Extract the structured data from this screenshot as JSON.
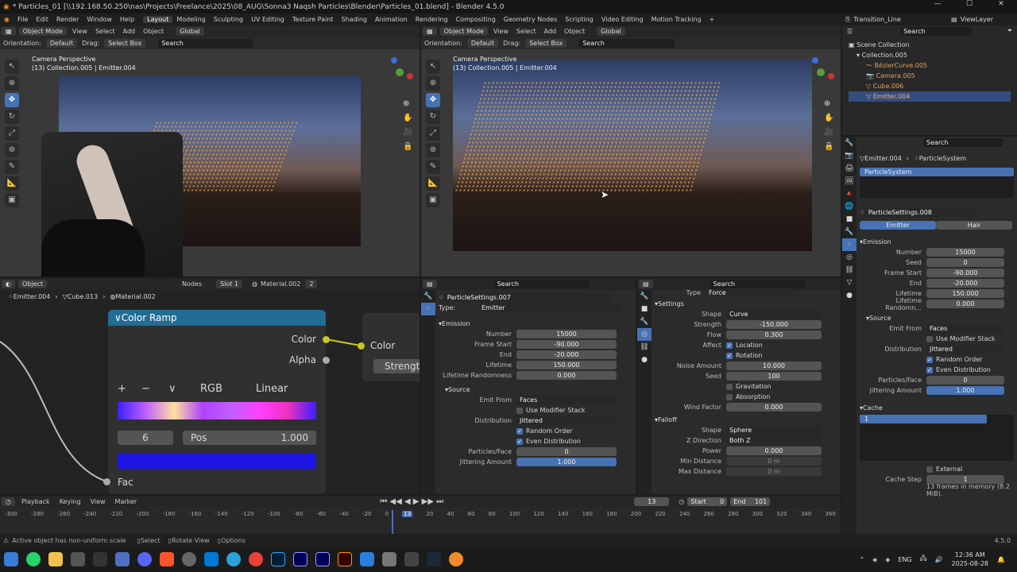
{
  "window": {
    "title": "* Particles_01 [\\\\192.168.50.250\\nas\\Projects\\Freelance\\2025\\08_AUG\\Sonna3 Naqsh Particles\\Blender\\Particles_01.blend] - Blender 4.5.0"
  },
  "menu": [
    "File",
    "Edit",
    "Render",
    "Window",
    "Help"
  ],
  "workspaces": [
    "Layout",
    "Modeling",
    "Sculpting",
    "UV Editing",
    "Texture Paint",
    "Shading",
    "Animation",
    "Rendering",
    "Compositing",
    "Geometry Nodes",
    "Scripting",
    "Video Editing",
    "Motion Tracking",
    "+"
  ],
  "scene_name": "Transition_Line",
  "view_layer": "ViewLayer",
  "viewport_header": {
    "mode": "Object Mode",
    "view": "View",
    "select": "Select",
    "add": "Add",
    "object": "Object",
    "orientation_label": "Orientation:",
    "orientation": "Default",
    "drag_label": "Drag:",
    "drag": "Select Box",
    "transform": "Global",
    "search_placeholder": "Search"
  },
  "viewport_left": {
    "title": "Camera Perspective",
    "subtitle": "(13) Collection.005 | Emitter.004"
  },
  "viewport_right": {
    "title": "Camera Perspective",
    "subtitle": "(13) Collection.005 | Emitter.004"
  },
  "outliner": {
    "search_placeholder": "Search",
    "root": "Scene Collection",
    "collection": "Collection.005",
    "items": [
      "BézierCurve.005",
      "Camera.005",
      "Cube.006",
      "Emitter.004"
    ]
  },
  "node_editor": {
    "header": {
      "object": "Object",
      "nodes": "Nodes",
      "slot": "Slot 1",
      "material": "Material.002",
      "users": "2"
    },
    "breadcrumb": [
      "Emitter.004",
      "Cube.013",
      "Material.002"
    ],
    "colorramp": {
      "title": "Color Ramp",
      "out_color": "Color",
      "out_alpha": "Alpha",
      "mode": "RGB",
      "interp": "Linear",
      "index": "6",
      "pos_label": "Pos",
      "pos_value": "1.000",
      "fac": "Fac",
      "plus": "+",
      "minus": "−",
      "chev": "∨"
    },
    "next_node": {
      "color": "Color",
      "strength": "Strengt"
    },
    "swatch_color": "#1f16e6"
  },
  "particle_mid": {
    "search_placeholder": "Search",
    "settings_name": "ParticleSettings.007",
    "type_label": "Type:",
    "type": "Emitter",
    "emission": "Emission",
    "number_label": "Number",
    "number": "15000",
    "frame_start_label": "Frame Start",
    "frame_start": "-90.000",
    "end_label": "End",
    "end": "-20.000",
    "lifetime_label": "Lifetime",
    "lifetime": "150.000",
    "lifetime_rand_label": "Lifetime Randomness",
    "lifetime_rand": "0.000",
    "source": "Source",
    "emit_from_label": "Emit From",
    "emit_from": "Faces",
    "use_modifier_stack": "Use Modifier Stack",
    "distribution_label": "Distribution",
    "distribution": "Jittered",
    "random_order": "Random Order",
    "even_distribution": "Even Distribution",
    "particles_face_label": "Particles/Face",
    "particles_face": "0",
    "jittering_label": "Jittering Amount",
    "jittering": "1.000"
  },
  "force_panel": {
    "search_placeholder": "Search",
    "type_label": "Type",
    "type": "Force",
    "settings": "Settings",
    "shape_label": "Shape",
    "shape": "Curve",
    "strength_label": "Strength",
    "strength": "-150.000",
    "flow_label": "Flow",
    "flow": "0.300",
    "affect_label": "Affect",
    "location": "Location",
    "rotation": "Rotation",
    "noise_label": "Noise Amount",
    "noise": "10.000",
    "seed_label": "Seed",
    "seed": "100",
    "gravitation": "Gravitation",
    "absorption": "Absorption",
    "wind_label": "Wind Factor",
    "wind": "0.000",
    "falloff": "Falloff",
    "f_shape_label": "Shape",
    "f_shape": "Sphere",
    "zdir_label": "Z Direction",
    "zdir": "Both Z",
    "power_label": "Power",
    "power": "0.000",
    "min_label": "Min Distance",
    "min": "0 m",
    "max_label": "Max Distance",
    "max": "0 m"
  },
  "properties": {
    "search_placeholder": "Search",
    "object": "Emitter.004",
    "system": "ParticleSystem",
    "list_item": "ParticleSystem",
    "settings": "ParticleSettings.008",
    "tab_emitter": "Emitter",
    "tab_hair": "Hair",
    "emission": "Emission",
    "number_label": "Number",
    "number": "15000",
    "seed_label": "Seed",
    "seed": "0",
    "frame_start_label": "Frame Start",
    "frame_start": "-90.000",
    "end_label": "End",
    "end": "-20.000",
    "lifetime_label": "Lifetime",
    "lifetime": "150.000",
    "lifetime_rand_label": "Lifetime Randomn...",
    "lifetime_rand": "0.000",
    "source": "Source",
    "emit_from_label": "Emit From",
    "emit_from": "Faces",
    "use_modifier_stack": "Use Modifier Stack",
    "distribution_label": "Distribution",
    "distribution": "Jittered",
    "random_order": "Random Order",
    "even_distribution": "Even Distribution",
    "particles_face_label": "Particles/Face",
    "particles_face": "0",
    "jittering_label": "Jittering Amount",
    "jittering": "1.000",
    "cache": "Cache",
    "cache_item": "1",
    "external": "External",
    "cache_step_label": "Cache Step",
    "cache_step": "1",
    "cache_info": "13 frames in memory (8.2 MiB)."
  },
  "timeline": {
    "playback": "Playback",
    "keying": "Keying",
    "view": "View",
    "marker": "Marker",
    "frame": "13",
    "start_label": "Start",
    "start": "0",
    "end_label": "End",
    "end": "101",
    "ticks": [
      "-300",
      "-280",
      "-260",
      "-240",
      "-220",
      "-200",
      "-180",
      "-160",
      "-140",
      "-120",
      "-100",
      "-80",
      "-60",
      "-40",
      "-20",
      "0",
      "13",
      "20",
      "40",
      "60",
      "80",
      "100",
      "120",
      "140",
      "160",
      "180",
      "200",
      "220",
      "240",
      "260",
      "280",
      "300",
      "320",
      "340",
      "360"
    ]
  },
  "statusbar": {
    "message": "Active object has non-uniform scale",
    "select": "Select",
    "rotate": "Rotate View",
    "options": "Options",
    "version": "4.5.0"
  },
  "taskbar": {
    "lang": "ENG",
    "time": "12:36 AM",
    "date": "2025-08-28"
  }
}
